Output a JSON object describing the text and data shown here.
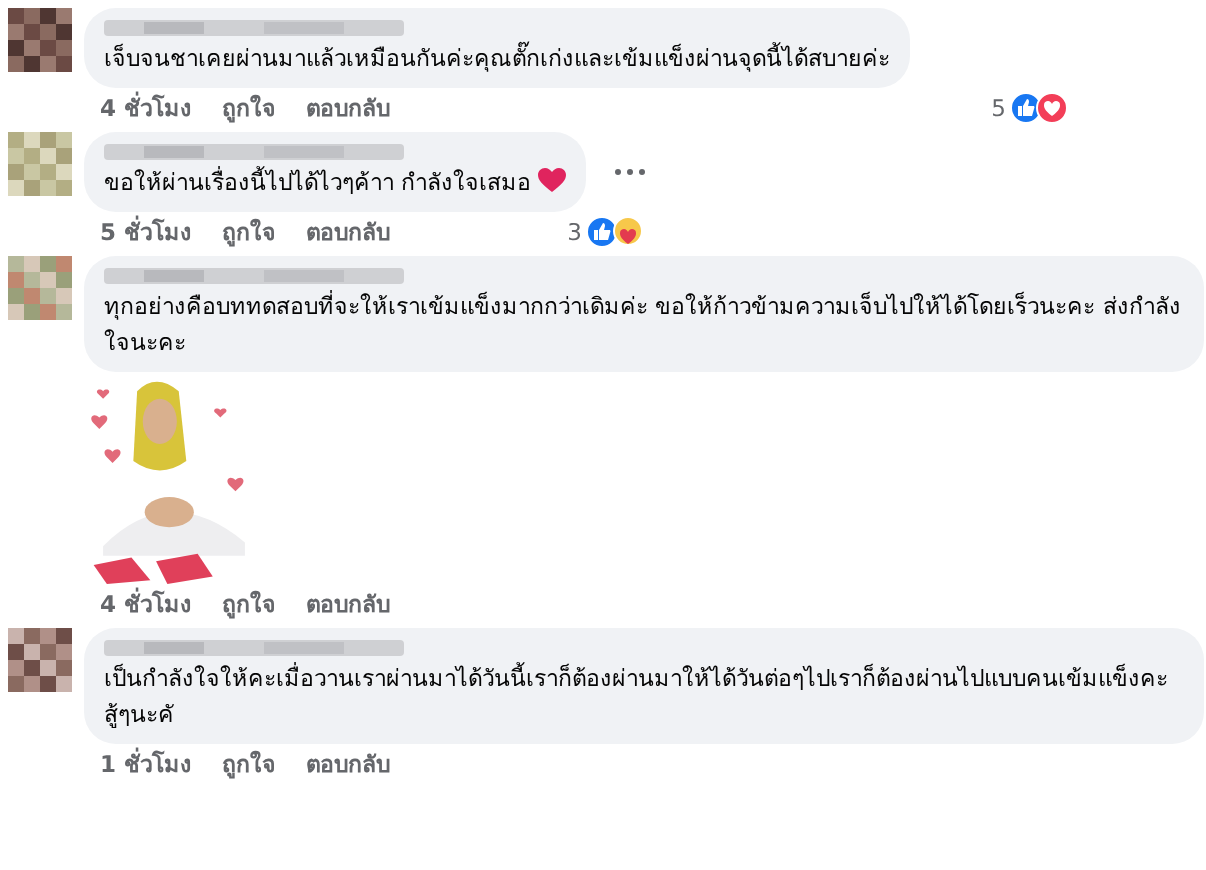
{
  "comments": [
    {
      "text": "เจ็บจนชาเคยผ่านมาแล้วเหมือนกันค่ะคุณตั๊กเก่งและเข้มแข็งผ่านจุดนี้ได้สบายค่ะ",
      "time": "4 ชั่วโมง",
      "like": "ถูกใจ",
      "reply": "ตอบกลับ",
      "reactions": {
        "count": "5",
        "icons": [
          {
            "kind": "like"
          },
          {
            "kind": "love"
          }
        ]
      }
    },
    {
      "text": "ขอให้ผ่านเรื่องนี้ไปได้ไวๆค้าา กำลังใจเสมอ",
      "heart": true,
      "more": true,
      "time": "5 ชั่วโมง",
      "like": "ถูกใจ",
      "reply": "ตอบกลับ",
      "reactions": {
        "count": "3",
        "icons": [
          {
            "kind": "like"
          },
          {
            "kind": "care"
          }
        ]
      }
    },
    {
      "text": "ทุกอย่างคือบททดสอบที่จะให้เราเข้มแข็งมากกว่าเดิมค่ะ ขอให้ก้าวข้ามความเจ็บไปให้ได้โดยเร็วนะคะ ส่งกำลังใจนะคะ",
      "time": "4 ชั่วโมง",
      "like": "ถูกใจ",
      "reply": "ตอบกลับ"
    },
    {
      "text": "เป็นกำลังใจให้คะเมื่อวานเราผ่านมาได้วันนี้เราก็ต้องผ่านมาให้ได้วันต่อๆไปเราก็ต้องผ่านไปแบบคนเข้มแข็งคะสู้ๆนะคั",
      "time": "1 ชั่วโมง",
      "like": "ถูกใจ",
      "reply": "ตอบกลับ"
    }
  ]
}
